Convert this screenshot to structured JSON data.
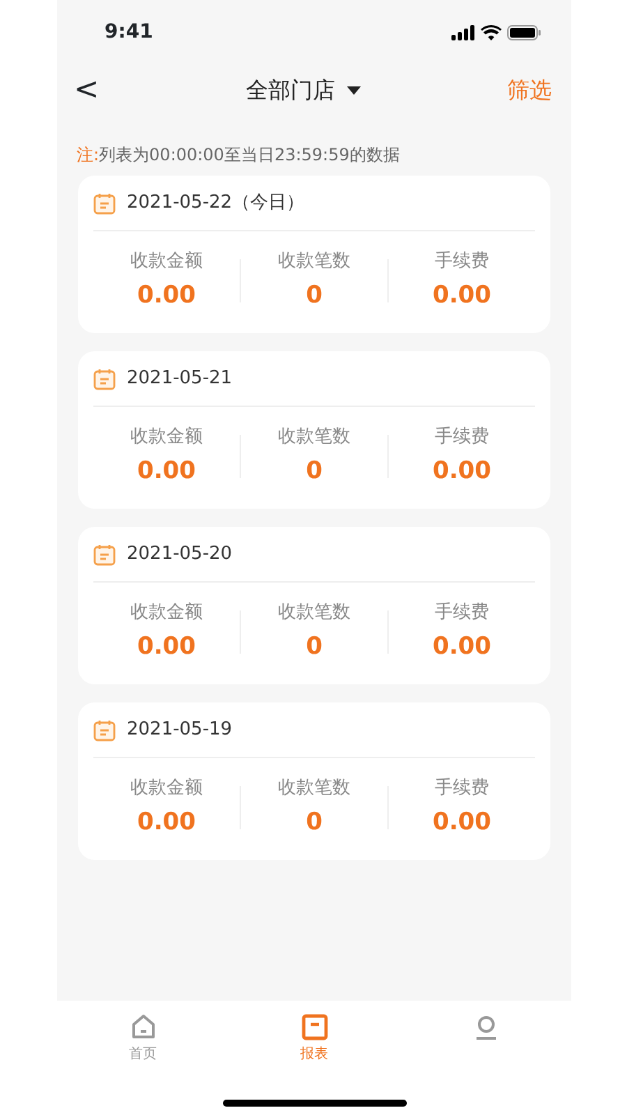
{
  "status_bar": {
    "time": "9:41"
  },
  "nav": {
    "back": "<",
    "title": "全部门店",
    "filter": "筛选"
  },
  "note": {
    "label": "注:",
    "text": "列表为00:00:00至当日23:59:59的数据"
  },
  "days": [
    {
      "date": "2021-05-22（今日）",
      "stats": [
        {
          "label": "收款金额",
          "value": "0.00"
        },
        {
          "label": "收款笔数",
          "value": "0"
        },
        {
          "label": "手续费",
          "value": "0.00"
        }
      ]
    },
    {
      "date": "2021-05-21",
      "stats": [
        {
          "label": "收款金额",
          "value": "0.00"
        },
        {
          "label": "收款笔数",
          "value": "0"
        },
        {
          "label": "手续费",
          "value": "0.00"
        }
      ]
    },
    {
      "date": "2021-05-20",
      "stats": [
        {
          "label": "收款金额",
          "value": "0.00"
        },
        {
          "label": "收款笔数",
          "value": "0"
        },
        {
          "label": "手续费",
          "value": "0.00"
        }
      ]
    },
    {
      "date": "2021-05-19",
      "stats": [
        {
          "label": "收款金额",
          "value": "0.00"
        },
        {
          "label": "收款笔数",
          "value": "0"
        },
        {
          "label": "手续费",
          "value": "0.00"
        }
      ]
    }
  ],
  "tabs": [
    {
      "kind": "home",
      "label": "首页",
      "selected": false
    },
    {
      "kind": "report",
      "label": "报表",
      "selected": true
    },
    {
      "kind": "profile",
      "selected": false
    }
  ]
}
